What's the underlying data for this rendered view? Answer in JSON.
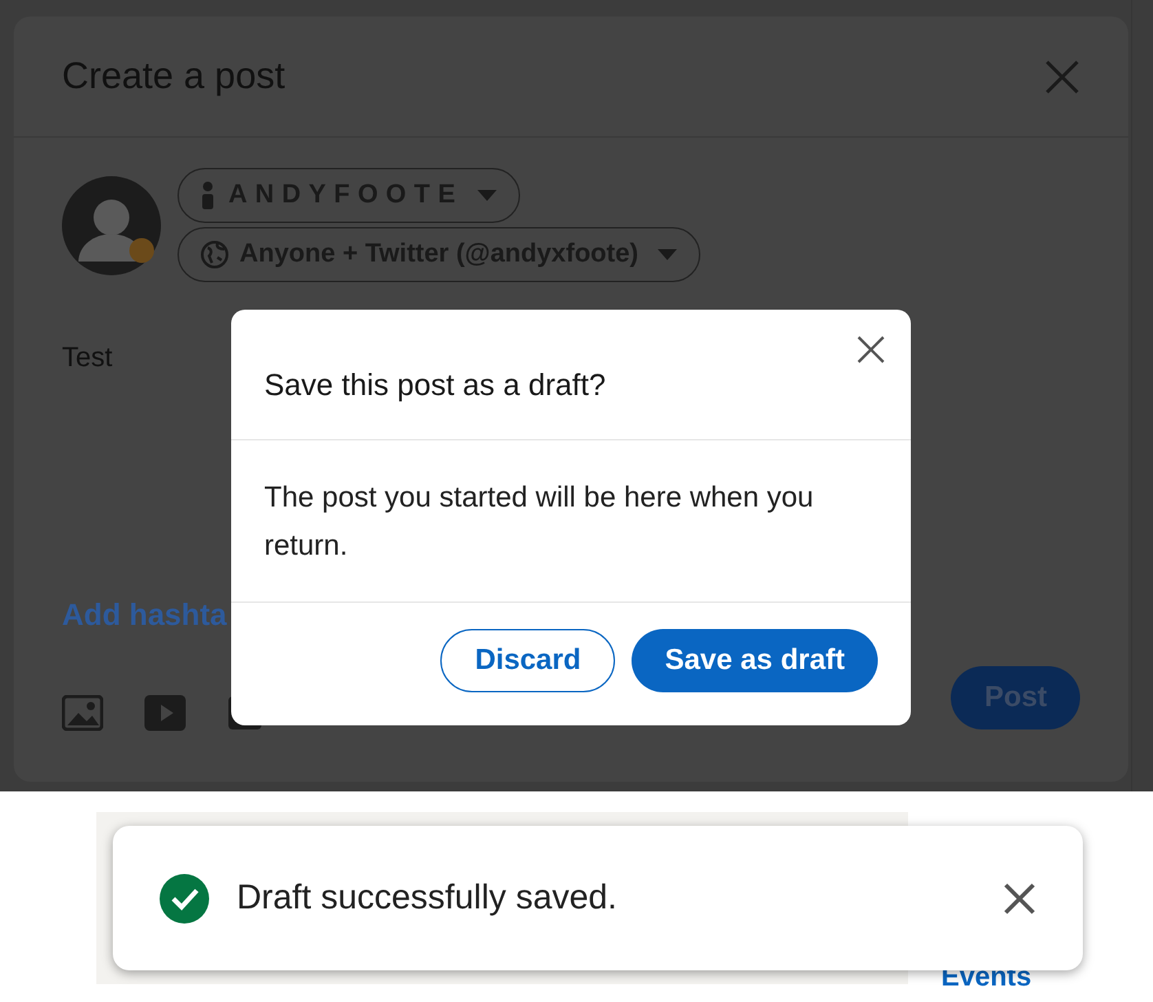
{
  "composer": {
    "title": "Create a post",
    "author": "ANDYFOOTE",
    "audience": "Anyone + Twitter (@andyxfoote)",
    "text": "Test",
    "hashtag_link": "Add hashta",
    "post_button": "Post"
  },
  "dialog": {
    "title": "Save this post as a draft?",
    "message": "The post you started will be here when you return.",
    "buttons": [
      {
        "label": "Discard",
        "kind": "secondary"
      },
      {
        "label": "Save as draft",
        "kind": "primary"
      }
    ]
  },
  "toast": {
    "message": "Draft successfully saved."
  },
  "below": {
    "link": "Events"
  }
}
